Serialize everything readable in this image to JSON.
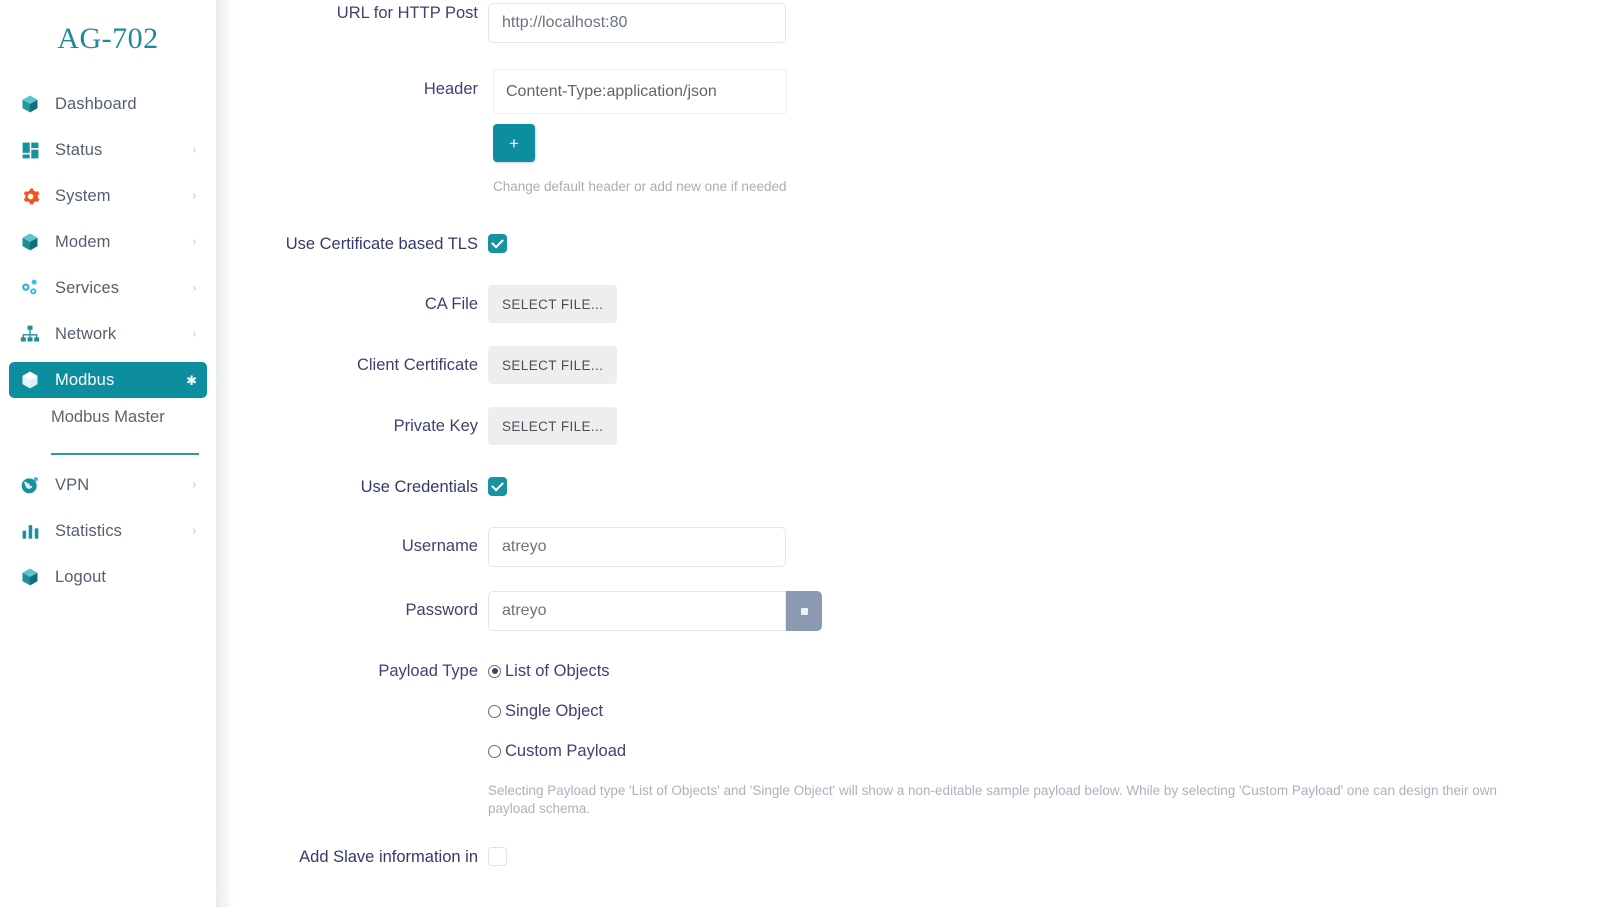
{
  "sidebar": {
    "brand": "AG-702",
    "items": [
      {
        "label": "Dashboard",
        "icon": "cube-icon",
        "chevron": false,
        "active": false
      },
      {
        "label": "Status",
        "icon": "grid-icon",
        "chevron": true,
        "active": false
      },
      {
        "label": "System",
        "icon": "gear-icon",
        "chevron": true,
        "active": false
      },
      {
        "label": "Modem",
        "icon": "cube-icon",
        "chevron": true,
        "active": false
      },
      {
        "label": "Services",
        "icon": "nodes-icon",
        "chevron": true,
        "active": false
      },
      {
        "label": "Network",
        "icon": "sitemap-icon",
        "chevron": true,
        "active": false
      },
      {
        "label": "Modbus",
        "icon": "cube-icon",
        "chevron": true,
        "active": true
      },
      {
        "label": "VPN",
        "icon": "globe-icon",
        "chevron": true,
        "active": false
      },
      {
        "label": "Statistics",
        "icon": "bar-chart-icon",
        "chevron": true,
        "active": false
      },
      {
        "label": "Logout",
        "icon": "cube-icon",
        "chevron": false,
        "active": false
      }
    ],
    "submenu": {
      "label": "Modbus Master"
    },
    "accent_color": "#0d8e9e",
    "brand_color": "#1f8a97"
  },
  "form": {
    "url": {
      "label": "URL for HTTP Post",
      "value": "http://localhost:80",
      "placeholder": "http://localhost:80"
    },
    "header": {
      "label": "Header",
      "value": "Content-Type:application/json",
      "placeholder": "Content-Type:application/json",
      "add_button_label": "+",
      "hint": "Change default header or add new one if needed"
    },
    "tls": {
      "label": "Use Certificate based TLS",
      "checked": true
    },
    "ca_file": {
      "label": "CA File",
      "button_label": "SELECT FILE..."
    },
    "client_certificate": {
      "label": "Client Certificate",
      "button_label": "SELECT FILE..."
    },
    "private_key": {
      "label": "Private Key",
      "button_label": "SELECT FILE..."
    },
    "use_credentials": {
      "label": "Use Credentials",
      "checked": true
    },
    "username": {
      "label": "Username",
      "value": "atreyo",
      "placeholder": "atreyo"
    },
    "password": {
      "label": "Password",
      "value": "atreyo",
      "placeholder": "atreyo",
      "toggle_icon": "eye-icon"
    },
    "payload_type": {
      "label": "Payload Type",
      "options": [
        {
          "label": "List of Objects",
          "selected": true
        },
        {
          "label": "Single Object",
          "selected": false
        },
        {
          "label": "Custom Payload",
          "selected": false
        }
      ],
      "hint": "Selecting Payload type 'List of Objects' and 'Single Object' will show a non-editable sample payload below. While by selecting 'Custom Payload' one can design their own payload schema."
    },
    "add_slave_info": {
      "label": "Add Slave information in",
      "checked": false
    }
  }
}
